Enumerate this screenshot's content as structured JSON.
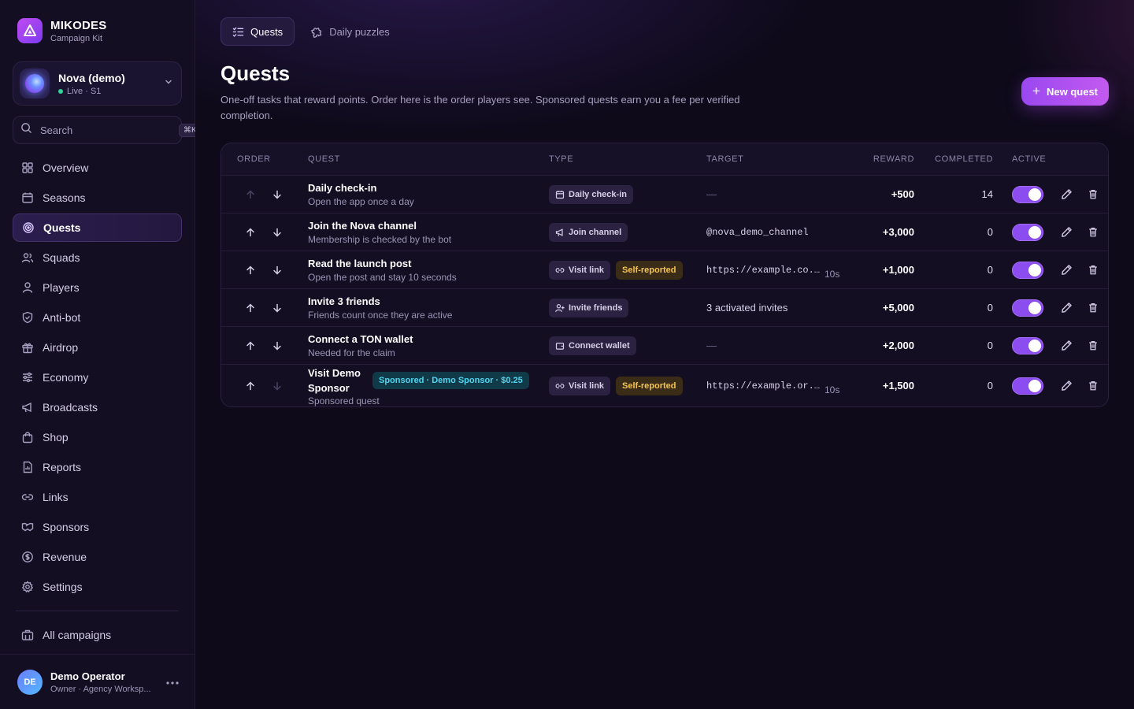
{
  "brand": {
    "name": "MIKODES",
    "subtitle": "Campaign Kit"
  },
  "workspace": {
    "name": "Nova (demo)",
    "status": "Live · S1"
  },
  "search": {
    "placeholder": "Search",
    "shortcut": "⌘K"
  },
  "nav": [
    {
      "label": "Overview",
      "icon": "grid-icon"
    },
    {
      "label": "Seasons",
      "icon": "calendar-icon"
    },
    {
      "label": "Quests",
      "icon": "target-icon",
      "active": true
    },
    {
      "label": "Squads",
      "icon": "users-icon"
    },
    {
      "label": "Players",
      "icon": "user-icon"
    },
    {
      "label": "Anti-bot",
      "icon": "shield-icon"
    },
    {
      "label": "Airdrop",
      "icon": "gift-icon"
    },
    {
      "label": "Economy",
      "icon": "sliders-icon"
    },
    {
      "label": "Broadcasts",
      "icon": "megaphone-icon"
    },
    {
      "label": "Shop",
      "icon": "bag-icon"
    },
    {
      "label": "Reports",
      "icon": "report-icon"
    },
    {
      "label": "Links",
      "icon": "link-icon"
    },
    {
      "label": "Sponsors",
      "icon": "handshake-icon"
    },
    {
      "label": "Revenue",
      "icon": "dollar-icon"
    },
    {
      "label": "Settings",
      "icon": "gear-icon"
    }
  ],
  "all_campaigns": "All campaigns",
  "user": {
    "initials": "DE",
    "name": "Demo Operator",
    "role": "Owner · Agency Worksp..."
  },
  "tabs": [
    {
      "label": "Quests",
      "icon": "checklist-icon",
      "active": true
    },
    {
      "label": "Daily puzzles",
      "icon": "puzzle-icon"
    }
  ],
  "page": {
    "title": "Quests",
    "description": "One-off tasks that reward points. Order here is the order players see. Sponsored quests earn you a fee per verified completion.",
    "new_button": "New quest"
  },
  "table": {
    "headers": {
      "order": "Order",
      "quest": "Quest",
      "type": "Type",
      "target": "Target",
      "reward": "Reward",
      "completed": "Completed",
      "active": "Active"
    },
    "rows": [
      {
        "title": "Daily check-in",
        "subtitle": "Open the app once a day",
        "type": "Daily check-in",
        "type_icon": "calendar-icon",
        "self_reported": "",
        "target": "—",
        "target_kind": "none",
        "target_extra": "",
        "reward": "+500",
        "completed": "14",
        "active": true,
        "up_enabled": false,
        "down_enabled": true
      },
      {
        "title": "Join the Nova channel",
        "subtitle": "Membership is checked by the bot",
        "type": "Join channel",
        "type_icon": "megaphone-icon",
        "self_reported": "",
        "target": "@nova_demo_channel",
        "target_kind": "mono",
        "target_extra": "",
        "reward": "+3,000",
        "completed": "0",
        "active": true,
        "up_enabled": true,
        "down_enabled": true
      },
      {
        "title": "Read the launch post",
        "subtitle": "Open the post and stay 10 seconds",
        "type": "Visit link",
        "type_icon": "link-icon",
        "self_reported": "Self-reported",
        "target": "https://example.co...",
        "target_kind": "mono",
        "target_extra": "10s",
        "reward": "+1,000",
        "completed": "0",
        "active": true,
        "up_enabled": true,
        "down_enabled": true
      },
      {
        "title": "Invite 3 friends",
        "subtitle": "Friends count once they are active",
        "type": "Invite friends",
        "type_icon": "user-plus-icon",
        "self_reported": "",
        "target": "3 activated invites",
        "target_kind": "text",
        "target_extra": "",
        "reward": "+5,000",
        "completed": "0",
        "active": true,
        "up_enabled": true,
        "down_enabled": true
      },
      {
        "title": "Connect a TON wallet",
        "subtitle": "Needed for the claim",
        "type": "Connect wallet",
        "type_icon": "wallet-icon",
        "self_reported": "",
        "target": "—",
        "target_kind": "none",
        "target_extra": "",
        "reward": "+2,000",
        "completed": "0",
        "active": true,
        "up_enabled": true,
        "down_enabled": true
      },
      {
        "title": "Visit Demo Sponsor",
        "subtitle": "Sponsored quest",
        "sponsor": "Sponsored · Demo Sponsor · $0.25",
        "type": "Visit link",
        "type_icon": "link-icon",
        "self_reported": "Self-reported",
        "target": "https://example.or...",
        "target_kind": "mono",
        "target_extra": "10s",
        "reward": "+1,500",
        "completed": "0",
        "active": true,
        "up_enabled": true,
        "down_enabled": false
      }
    ]
  },
  "colors": {
    "accent": "#8b4cf0",
    "self_reported": "#f5c451",
    "sponsored": "#52d4ef",
    "live": "#34d399"
  }
}
